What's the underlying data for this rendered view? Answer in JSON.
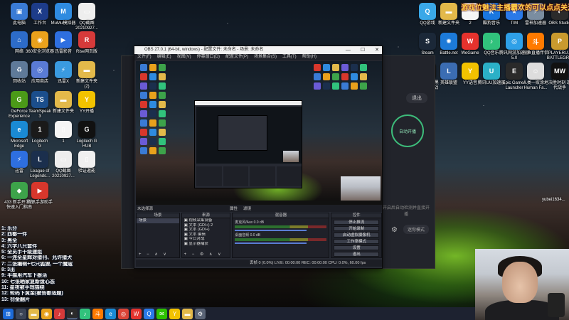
{
  "banner": "游戏位魅法主播霸欢的可以点点关注",
  "desktop_icons": [
    {
      "label": "此电脑",
      "icon": "computer-icon",
      "color": "#3a7bd5",
      "glyph": "▣"
    },
    {
      "label": "网络",
      "icon": "network-icon",
      "color": "#2d6cc9",
      "glyph": "⌂"
    },
    {
      "label": "回收站",
      "icon": "recycle-bin-icon",
      "color": "#5f7a99",
      "glyph": "♻"
    },
    {
      "label": "GeForce\nExperience",
      "icon": "geforce-icon",
      "color": "#4b9a18",
      "glyph": "G"
    },
    {
      "label": "Microsoft\nEdge",
      "icon": "edge-icon",
      "color": "#1a8ad4",
      "glyph": "e"
    },
    {
      "label": "迅雷",
      "icon": "thunder-icon",
      "color": "#2e6fe0",
      "glyph": "⚡"
    },
    {
      "label": "433 新手开发者\n快速入门指南",
      "icon": "game-icon",
      "color": "#3da34a",
      "glyph": "◆"
    },
    {
      "label": "工作台",
      "icon": "workbench-icon",
      "color": "#1d3c8a",
      "glyph": "X"
    },
    {
      "label": "360安全浏览器",
      "icon": "360-browser-icon",
      "color": "#e9a11c",
      "glyph": "◉"
    },
    {
      "label": "应用商店",
      "icon": "store-icon",
      "color": "#5a7bd5",
      "glyph": "◎"
    },
    {
      "label": "TeamSpeak\n3",
      "icon": "teamspeak-icon",
      "color": "#1b4e8c",
      "glyph": "TS"
    },
    {
      "label": "Logitech\nG",
      "icon": "logitech-icon",
      "color": "#1a1a1a",
      "glyph": "1"
    },
    {
      "label": "League of\nLegends...",
      "icon": "lol-icon",
      "color": "#1b2f4d",
      "glyph": "L"
    },
    {
      "label": "腾讯手游助手",
      "icon": "tencent-icon",
      "color": "#d8372c",
      "glyph": "▶"
    },
    {
      "label": "MuMu模拟器",
      "icon": "mumu-icon",
      "color": "#2f8be0",
      "glyph": "M"
    },
    {
      "label": "迅雷影音",
      "icon": "thunder-player-icon",
      "color": "#2e6fe0",
      "glyph": "▶"
    },
    {
      "label": "迅雷X",
      "icon": "thunderx-icon",
      "color": "#3a9be0",
      "glyph": "⚡"
    },
    {
      "label": "新建文件夹",
      "icon": "folder-icon",
      "color": "#e3b94a",
      "glyph": "▬"
    },
    {
      "label": "1",
      "icon": "file-icon",
      "color": "#f5f5f5",
      "glyph": "▯"
    },
    {
      "label": "QQ截图\n20210927...",
      "icon": "screenshot-icon",
      "color": "#eeeeee",
      "glyph": "▭"
    },
    {
      "label": "QQ截图\n20210927...",
      "icon": "screenshot-icon",
      "color": "#eeeeee",
      "glyph": "▭"
    },
    {
      "label": "Rise网页版",
      "icon": "rise-icon",
      "color": "#d63a3a",
      "glyph": "R"
    },
    {
      "label": "新建文件夹\n(2)",
      "icon": "folder-icon",
      "color": "#e3b94a",
      "glyph": "▬"
    },
    {
      "label": "YY开播",
      "icon": "yy-icon",
      "color": "#f2c200",
      "glyph": "Y"
    },
    {
      "label": "Logitech G\nHUB",
      "icon": "ghub-icon",
      "color": "#111111",
      "glyph": "G"
    },
    {
      "label": "验证邀能",
      "icon": "doc-icon",
      "color": "#f0f0f0",
      "glyph": "▯"
    },
    {
      "label": "QQ游戏",
      "icon": "qq-game-icon",
      "color": "#3aa8e8",
      "glyph": "Q"
    },
    {
      "label": "新建文件夹",
      "icon": "folder-icon",
      "color": "#e3b94a",
      "glyph": "▬"
    },
    {
      "label": "2",
      "icon": "file-icon",
      "color": "#f5f5f5",
      "glyph": "▯"
    },
    {
      "label": "酷狗音乐",
      "icon": "kugou-icon",
      "color": "#1a77e0",
      "glyph": "K"
    },
    {
      "label": "TIM",
      "icon": "tim-icon",
      "color": "#2a79e8",
      "glyph": "★"
    },
    {
      "label": "雷神加速器",
      "icon": "leishen-icon",
      "color": "#7a8da0",
      "glyph": "⚡"
    },
    {
      "label": "OBS Studio",
      "icon": "obs-icon",
      "color": "#2b2b2b",
      "glyph": "◐"
    },
    {
      "label": "Steam",
      "icon": "steam-icon",
      "color": "#1b2838",
      "glyph": "S"
    },
    {
      "label": "Battle.net",
      "icon": "battlenet-icon",
      "color": "#1c7ad8",
      "glyph": "✺"
    },
    {
      "label": "WeGame",
      "icon": "wegame-icon",
      "color": "#e5322d",
      "glyph": "W"
    },
    {
      "label": "QQ音乐",
      "icon": "qq-music-icon",
      "color": "#31c27c",
      "glyph": "♪"
    },
    {
      "label": "腾讯网游加速器5.0",
      "icon": "accelerator-icon",
      "color": "#2ea0e8",
      "glyph": "◎"
    },
    {
      "label": "斗鱼直播伴侣",
      "icon": "douyu-icon",
      "color": "#ff7a00",
      "glyph": "斗"
    },
    {
      "label": "PLAYERU...\nBATTLEGR...",
      "icon": "pubg-icon",
      "color": "#c99a2e",
      "glyph": "P"
    },
    {
      "label": "决胜时刻 黑\n色行动冷战",
      "icon": "cod-icon",
      "color": "#111111",
      "glyph": "B"
    },
    {
      "label": "英雄联盟",
      "icon": "lol-client-icon",
      "color": "#3b6db3",
      "glyph": "L"
    },
    {
      "label": "YY语音",
      "icon": "yy-voice-icon",
      "color": "#f2c200",
      "glyph": "Y"
    },
    {
      "label": "腾讯UU加速器",
      "icon": "uu-icon",
      "color": "#2bb0c7",
      "glyph": "U"
    },
    {
      "label": "Epic Games\nLauncher",
      "icon": "epic-icon",
      "color": "#2a2a2a",
      "glyph": "E"
    },
    {
      "label": "人类一败涂地\nHuman Fa...",
      "icon": "human-icon",
      "color": "#dddddd",
      "glyph": "☺"
    },
    {
      "label": "决胜时刻 现\n代战争",
      "icon": "mw-icon",
      "color": "#111111",
      "glyph": "MW"
    },
    {
      "label": "完美对战平台",
      "icon": "perfect-icon",
      "color": "#1e1e1e",
      "glyph": "✦"
    }
  ],
  "right_tray_label": "yubei1634...",
  "chat_lines": [
    "1: 乐芬",
    "2: 西都一件",
    "3: 黑全",
    "4: 六字八只套件",
    "5: 全员手十级速组",
    "6: 一连全星辉对猎刊、允许猎犬",
    "7: 二张编辑+七只狐狸, 一个魔寇",
    "8: 3出",
    "9: 平猫用汽车下狠活",
    "10: 七张晒家复新盘心态",
    "11: 星夜被手戏描绕",
    "12: 轮码下黄金(被告都适题)",
    "13: 罚金翻片"
  ],
  "background_app": {
    "exit_label": "退出",
    "ring_label": "自动开播",
    "hint": "开启后自动检测并直接开播",
    "mini_label": "迷你模式"
  },
  "obs": {
    "title": "OBS 27.0.1 (64-bit, windows) - 配置文件: 未命名 - 场景: 未命名",
    "menu": [
      "文件(F)",
      "编辑(E)",
      "视图(V)",
      "停靠窗口(D)",
      "配置文件(P)",
      "场景集合(S)",
      "工具(T)",
      "帮助(H)"
    ],
    "bar_items": [
      "未选择源",
      "属性",
      "滤镜"
    ],
    "docks": {
      "scenes": {
        "header": "场景",
        "items": [
          "场景"
        ],
        "footer": "+ − ∧ ∨"
      },
      "sources": {
        "header": "来源",
        "items": [
          "视频采集设备",
          "文本 (GDI+) 2",
          "文本 (GDI+)",
          "文本 编辑",
          "今日对战",
          "显示器捕获"
        ],
        "footer": "+ − ⚙ ∧ ∨"
      },
      "mixer": {
        "header": "混音器",
        "tracks": [
          {
            "name": "麦克风/Aux",
            "db": "0.0 dB"
          },
          {
            "name": "桌面音频",
            "db": "0.0 dB"
          }
        ]
      },
      "controls": {
        "header": "控件",
        "buttons": [
          "停止推流",
          "开始录制",
          "启动虚拟摄像机",
          "工作室模式",
          "设置",
          "退出"
        ]
      }
    },
    "status": "丢帧 0 (0.0%)   LIVE: 00:00:00   REC: 00:00:00   CPU: 0.0%, 60.00 fps"
  },
  "taskbar_apps": [
    {
      "icon": "start-icon",
      "color": "#1c6ad8",
      "glyph": "⊞"
    },
    {
      "icon": "search-taskbar-icon",
      "color": "#3b4456",
      "glyph": "○"
    },
    {
      "icon": "explorer-icon",
      "color": "#e3b94a",
      "glyph": "▬"
    },
    {
      "icon": "browser-taskbar-icon",
      "color": "#e9a11c",
      "glyph": "◉"
    },
    {
      "icon": "netease-icon",
      "color": "#d63a3a",
      "glyph": "♪"
    },
    {
      "icon": "obs-taskbar-icon",
      "color": "#2b2b2b",
      "glyph": "◐"
    },
    {
      "icon": "qqmusic-taskbar-icon",
      "color": "#31c27c",
      "glyph": "♪"
    },
    {
      "icon": "douyu-taskbar-icon",
      "color": "#ff7a00",
      "glyph": "斗"
    },
    {
      "icon": "edge-taskbar-icon",
      "color": "#1a8ad4",
      "glyph": "e"
    },
    {
      "icon": "chrome-taskbar-icon",
      "color": "#db4437",
      "glyph": "◎"
    },
    {
      "icon": "wegame-taskbar-icon",
      "color": "#e5322d",
      "glyph": "W"
    },
    {
      "icon": "qq-taskbar-icon",
      "color": "#2a79e8",
      "glyph": "Q"
    },
    {
      "icon": "wechat-taskbar-icon",
      "color": "#2dc100",
      "glyph": "✉"
    },
    {
      "icon": "yy-taskbar-icon",
      "color": "#f2c200",
      "glyph": "Y"
    },
    {
      "icon": "folder-taskbar-icon",
      "color": "#e3b94a",
      "glyph": "▬"
    },
    {
      "icon": "settings-taskbar-icon",
      "color": "#5a6476",
      "glyph": "⚙"
    }
  ]
}
